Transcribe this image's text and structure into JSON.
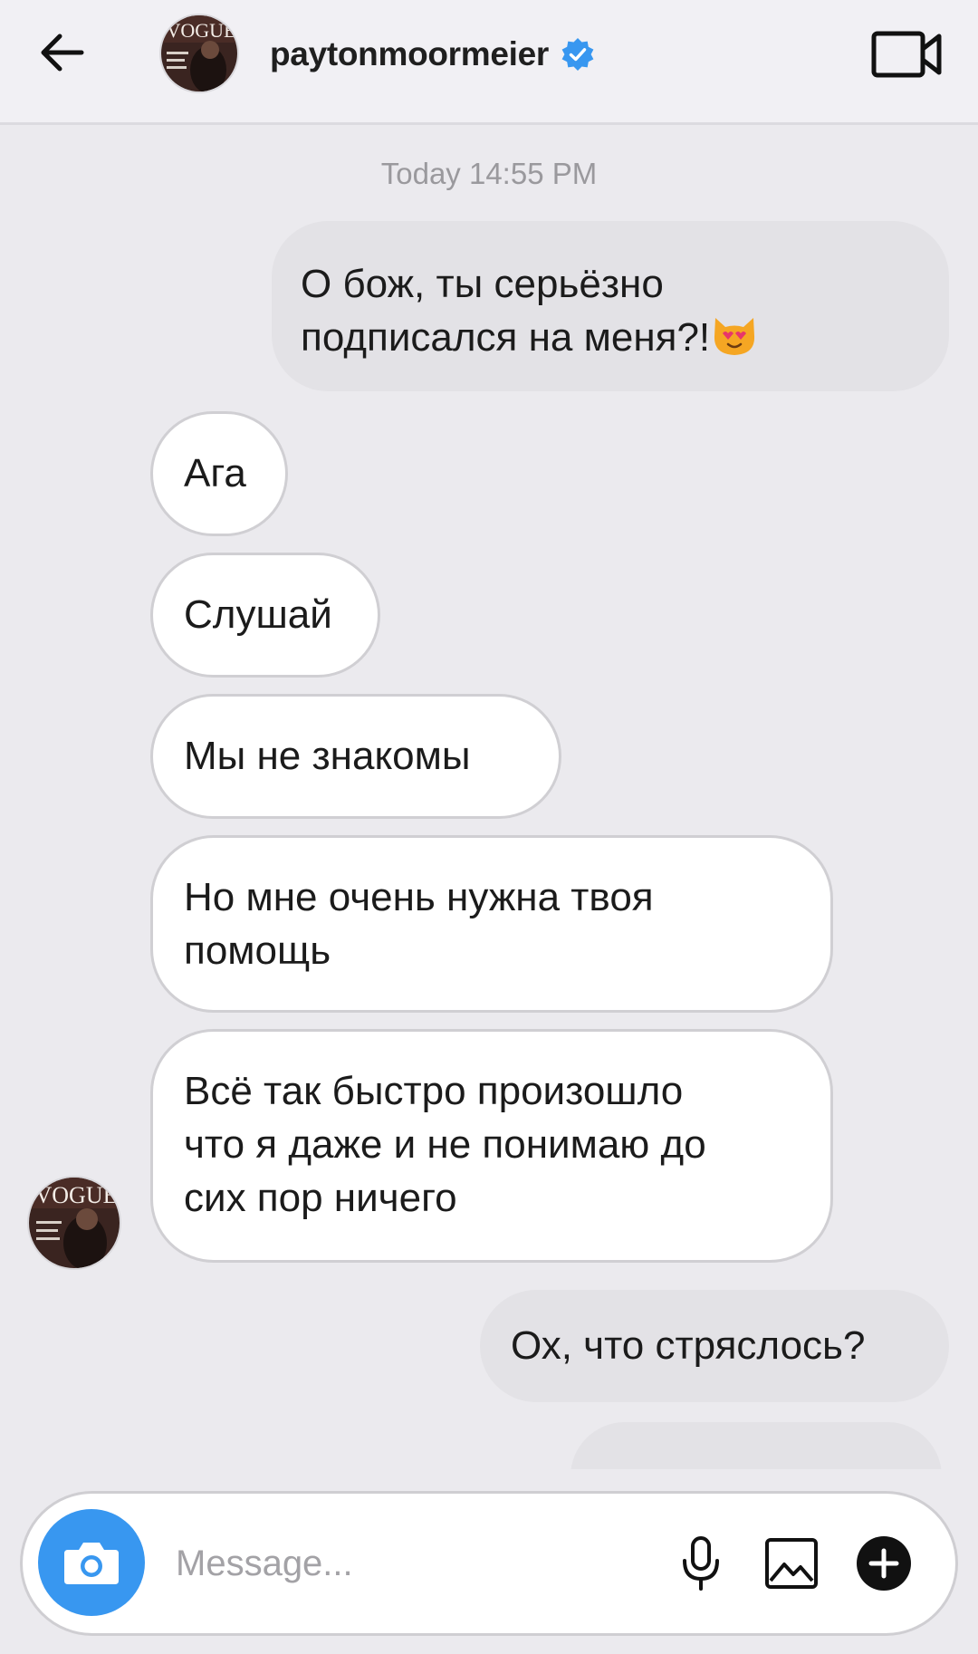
{
  "header": {
    "username": "paytonmoormeier",
    "verified": true,
    "back_icon": "arrow-left-icon",
    "video_icon": "video-call-icon",
    "avatar_text": "VOGUE"
  },
  "conversation": {
    "timestamp": "Today 14:55 PM",
    "messages": [
      {
        "direction": "outgoing",
        "lines": [
          "О бож, ты серьёзно",
          "подписался на меня?!"
        ],
        "emoji": "heart-eyes-cat-emoji"
      },
      {
        "direction": "incoming",
        "lines": [
          "Ага"
        ]
      },
      {
        "direction": "incoming",
        "lines": [
          "Слушай"
        ]
      },
      {
        "direction": "incoming",
        "lines": [
          "Мы не знакомы"
        ]
      },
      {
        "direction": "incoming",
        "lines": [
          "Но мне очень нужна твоя",
          "помощь"
        ]
      },
      {
        "direction": "incoming",
        "lines": [
          "Всё так быстро произошло",
          "что я даже и не понимаю до",
          "сих пор ничего"
        ]
      },
      {
        "direction": "outgoing",
        "lines": [
          "Ох, что стряслось?"
        ]
      }
    ]
  },
  "composer": {
    "placeholder": "Message...",
    "camera_icon": "camera-icon",
    "mic_icon": "microphone-icon",
    "gallery_icon": "gallery-icon",
    "plus_icon": "plus-circle-icon"
  },
  "colors": {
    "background": "#ebeaee",
    "header_background": "#f1f0f4",
    "outgoing_bubble": "#e3e2e6",
    "incoming_bubble": "#ffffff",
    "accent_blue": "#3897f0",
    "verified_blue": "#3897f0",
    "timestamp_text": "#9a999d"
  }
}
